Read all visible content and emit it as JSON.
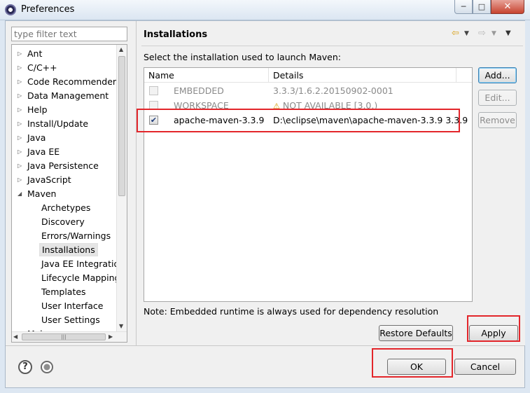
{
  "window": {
    "title": "Preferences"
  },
  "sidebar": {
    "filter_placeholder": "type filter text",
    "items": [
      {
        "label": "Ant",
        "level": 0,
        "arrow": "collapsed"
      },
      {
        "label": "C/C++",
        "level": 0,
        "arrow": "collapsed"
      },
      {
        "label": "Code Recommenders",
        "level": 0,
        "arrow": "collapsed"
      },
      {
        "label": "Data Management",
        "level": 0,
        "arrow": "collapsed"
      },
      {
        "label": "Help",
        "level": 0,
        "arrow": "collapsed"
      },
      {
        "label": "Install/Update",
        "level": 0,
        "arrow": "collapsed"
      },
      {
        "label": "Java",
        "level": 0,
        "arrow": "collapsed"
      },
      {
        "label": "Java EE",
        "level": 0,
        "arrow": "collapsed"
      },
      {
        "label": "Java Persistence",
        "level": 0,
        "arrow": "collapsed"
      },
      {
        "label": "JavaScript",
        "level": 0,
        "arrow": "collapsed"
      },
      {
        "label": "Maven",
        "level": 0,
        "arrow": "expanded"
      },
      {
        "label": "Archetypes",
        "level": 1
      },
      {
        "label": "Discovery",
        "level": 1
      },
      {
        "label": "Errors/Warnings",
        "level": 1
      },
      {
        "label": "Installations",
        "level": 1,
        "selected": true
      },
      {
        "label": "Java EE Integration",
        "level": 1
      },
      {
        "label": "Lifecycle Mapping",
        "level": 1
      },
      {
        "label": "Templates",
        "level": 1
      },
      {
        "label": "User Interface",
        "level": 1
      },
      {
        "label": "User Settings",
        "level": 1
      },
      {
        "label": "Mylyn",
        "level": 0,
        "arrow": "collapsed"
      }
    ]
  },
  "page": {
    "title": "Installations",
    "instruction": "Select the installation used to launch Maven:",
    "note": "Note: Embedded runtime is always used for dependency resolution"
  },
  "table": {
    "columns": [
      "Name",
      "Details"
    ],
    "rows": [
      {
        "name": "EMBEDDED",
        "details": "3.3.3/1.6.2.20150902-0001",
        "checked": false,
        "disabled": true
      },
      {
        "name": "WORKSPACE",
        "details": "NOT AVAILABLE [3.0,)",
        "checked": false,
        "disabled": true,
        "warning": true
      },
      {
        "name": "apache-maven-3.3.9",
        "details": "D:\\eclipse\\maven\\apache-maven-3.3.9 3.3.9",
        "checked": true,
        "disabled": false
      }
    ]
  },
  "buttons": {
    "add": "Add...",
    "edit": "Edit...",
    "remove": "Remove",
    "restore_defaults": "Restore Defaults",
    "apply": "Apply",
    "ok": "OK",
    "cancel": "Cancel"
  },
  "icons": {
    "app": "eclipse-icon",
    "back": "back-arrow-icon",
    "forward": "forward-arrow-icon",
    "menu": "view-menu-icon",
    "help": "help-icon",
    "record": "record-icon",
    "warning": "warning-icon"
  },
  "colors": {
    "highlight": "#e3262b",
    "nav_arrow": "#d9a21a"
  }
}
